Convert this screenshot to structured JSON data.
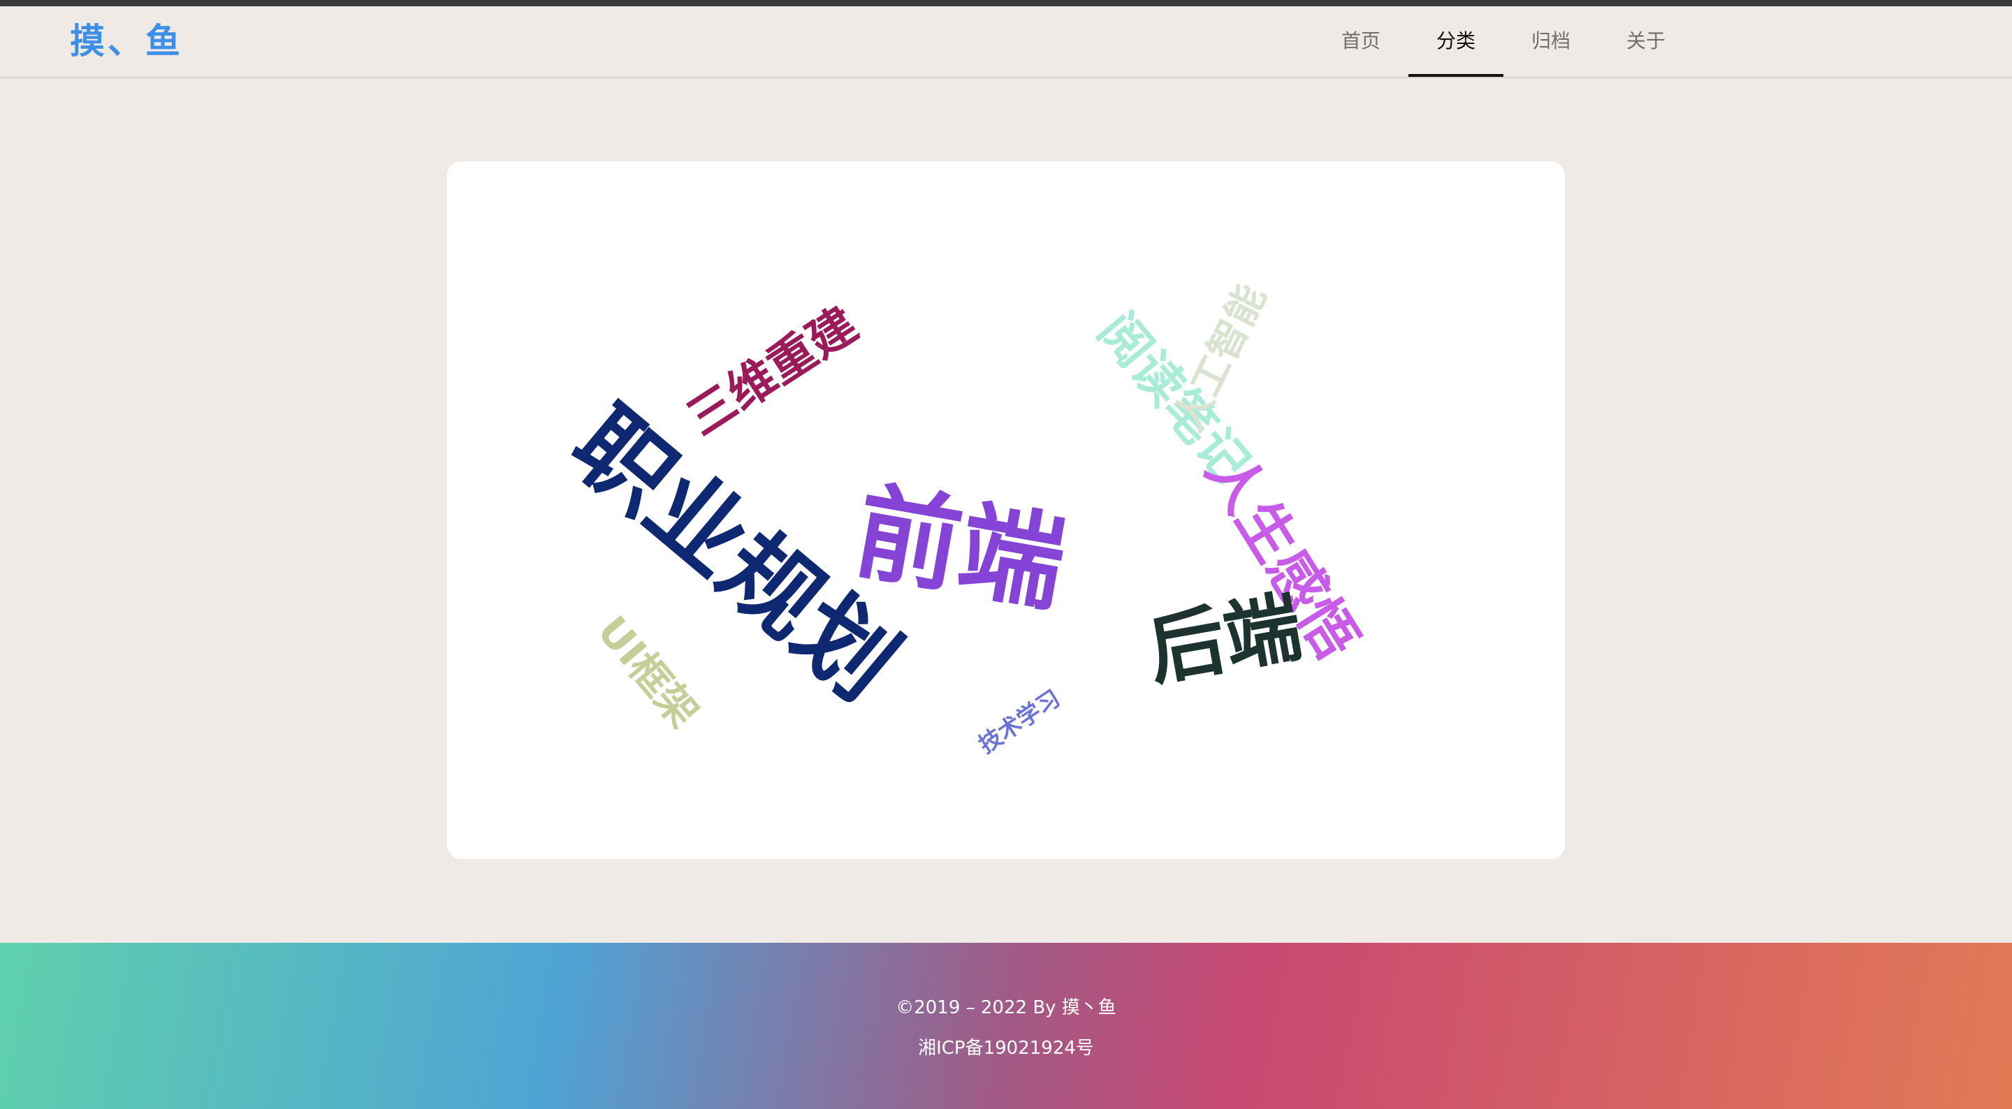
{
  "site": {
    "logo": "摸、鱼"
  },
  "nav": {
    "items": [
      {
        "label": "首页",
        "active": false
      },
      {
        "label": "分类",
        "active": true
      },
      {
        "label": "归档",
        "active": false
      },
      {
        "label": "关于",
        "active": false
      }
    ]
  },
  "word_cloud": {
    "words": [
      {
        "text": "职业规划",
        "color": "#0f2872"
      },
      {
        "text": "前端",
        "color": "#8544d6"
      },
      {
        "text": "三维重建",
        "color": "#9b1a5a"
      },
      {
        "text": "阅读笔记",
        "color": "#a8ecd8"
      },
      {
        "text": "人工智能",
        "color": "#d9e3cf"
      },
      {
        "text": "人生感悟",
        "color": "#c85ce8"
      },
      {
        "text": "后端",
        "color": "#1c3330"
      },
      {
        "text": "UI框架",
        "color": "#c7cd97"
      },
      {
        "text": "技术学习",
        "color": "#6a72d8"
      }
    ]
  },
  "footer": {
    "copyright": "©2019 – 2022 By 摸丶鱼",
    "icp": "湘ICP备19021924号"
  }
}
